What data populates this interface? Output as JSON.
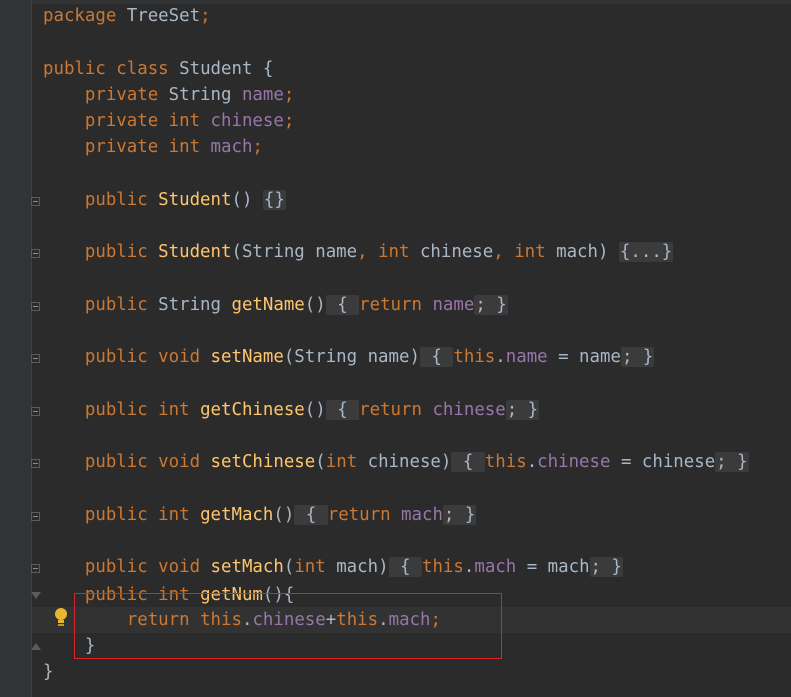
{
  "editor": {
    "lines": [
      {
        "segments": [
          {
            "t": "package ",
            "c": "kw"
          },
          {
            "t": "TreeSet",
            "c": ""
          },
          {
            "t": ";",
            "c": "op"
          }
        ]
      },
      {
        "segments": [
          {
            "t": "public ",
            "c": "kw"
          },
          {
            "t": "class ",
            "c": "kw"
          },
          {
            "t": "Student {",
            "c": ""
          }
        ]
      },
      {
        "segments": [
          {
            "t": "    private ",
            "c": "kw"
          },
          {
            "t": "String ",
            "c": ""
          },
          {
            "t": "name",
            "c": "fld"
          },
          {
            "t": ";",
            "c": "op"
          }
        ]
      },
      {
        "segments": [
          {
            "t": "    private ",
            "c": "kw"
          },
          {
            "t": "int ",
            "c": "kw"
          },
          {
            "t": "chinese",
            "c": "fld"
          },
          {
            "t": ";",
            "c": "op"
          }
        ]
      },
      {
        "segments": [
          {
            "t": "    private ",
            "c": "kw"
          },
          {
            "t": "int ",
            "c": "kw"
          },
          {
            "t": "mach",
            "c": "fld"
          },
          {
            "t": ";",
            "c": "op"
          }
        ]
      },
      {
        "segments": [
          {
            "t": "    public ",
            "c": "kw"
          },
          {
            "t": "Student",
            "c": "fn"
          },
          {
            "t": "() ",
            "c": ""
          },
          {
            "t": "{}",
            "c": "fold"
          }
        ]
      },
      {
        "segments": [
          {
            "t": "    public ",
            "c": "kw"
          },
          {
            "t": "Student",
            "c": "fn"
          },
          {
            "t": "(String name",
            "c": ""
          },
          {
            "t": ", ",
            "c": "op"
          },
          {
            "t": "int ",
            "c": "kw"
          },
          {
            "t": "chinese",
            "c": ""
          },
          {
            "t": ", ",
            "c": "op"
          },
          {
            "t": "int ",
            "c": "kw"
          },
          {
            "t": "mach) ",
            "c": ""
          },
          {
            "t": "{...}",
            "c": "fold"
          }
        ]
      },
      {
        "segments": [
          {
            "t": "    public ",
            "c": "kw"
          },
          {
            "t": "String ",
            "c": ""
          },
          {
            "t": "getName",
            "c": "fn"
          },
          {
            "t": "()",
            "c": ""
          },
          {
            "t": " { ",
            "c": "fold"
          },
          {
            "t": "return ",
            "c": "kw"
          },
          {
            "t": "name",
            "c": "fld"
          },
          {
            "t": "; }",
            "c": "fold"
          }
        ]
      },
      {
        "segments": [
          {
            "t": "    public ",
            "c": "kw"
          },
          {
            "t": "void ",
            "c": "kw"
          },
          {
            "t": "setName",
            "c": "fn"
          },
          {
            "t": "(String name)",
            "c": ""
          },
          {
            "t": " { ",
            "c": "fold"
          },
          {
            "t": "this",
            "c": "kw"
          },
          {
            "t": ".",
            "c": ""
          },
          {
            "t": "name",
            "c": "fld"
          },
          {
            "t": " = name",
            "c": ""
          },
          {
            "t": "; }",
            "c": "fold"
          }
        ]
      },
      {
        "segments": [
          {
            "t": "    public ",
            "c": "kw"
          },
          {
            "t": "int ",
            "c": "kw"
          },
          {
            "t": "getChinese",
            "c": "fn"
          },
          {
            "t": "()",
            "c": ""
          },
          {
            "t": " { ",
            "c": "fold"
          },
          {
            "t": "return ",
            "c": "kw"
          },
          {
            "t": "chinese",
            "c": "fld"
          },
          {
            "t": "; }",
            "c": "fold"
          }
        ]
      },
      {
        "segments": [
          {
            "t": "    public ",
            "c": "kw"
          },
          {
            "t": "void ",
            "c": "kw"
          },
          {
            "t": "setChinese",
            "c": "fn"
          },
          {
            "t": "(",
            "c": ""
          },
          {
            "t": "int ",
            "c": "kw"
          },
          {
            "t": "chinese)",
            "c": ""
          },
          {
            "t": " { ",
            "c": "fold"
          },
          {
            "t": "this",
            "c": "kw"
          },
          {
            "t": ".",
            "c": ""
          },
          {
            "t": "chinese",
            "c": "fld"
          },
          {
            "t": " = chinese",
            "c": ""
          },
          {
            "t": "; }",
            "c": "fold"
          }
        ]
      },
      {
        "segments": [
          {
            "t": "    public ",
            "c": "kw"
          },
          {
            "t": "int ",
            "c": "kw"
          },
          {
            "t": "getMach",
            "c": "fn"
          },
          {
            "t": "()",
            "c": ""
          },
          {
            "t": " { ",
            "c": "fold"
          },
          {
            "t": "return ",
            "c": "kw"
          },
          {
            "t": "mach",
            "c": "fld"
          },
          {
            "t": "; }",
            "c": "fold"
          }
        ]
      },
      {
        "segments": [
          {
            "t": "    public ",
            "c": "kw"
          },
          {
            "t": "void ",
            "c": "kw"
          },
          {
            "t": "setMach",
            "c": "fn"
          },
          {
            "t": "(",
            "c": ""
          },
          {
            "t": "int ",
            "c": "kw"
          },
          {
            "t": "mach)",
            "c": ""
          },
          {
            "t": " { ",
            "c": "fold"
          },
          {
            "t": "this",
            "c": "kw"
          },
          {
            "t": ".",
            "c": ""
          },
          {
            "t": "mach",
            "c": "fld"
          },
          {
            "t": " = mach",
            "c": ""
          },
          {
            "t": "; }",
            "c": "fold"
          }
        ]
      },
      {
        "segments": [
          {
            "t": "    public ",
            "c": "kw"
          },
          {
            "t": "int ",
            "c": "kw"
          },
          {
            "t": "getNum",
            "c": "fn"
          },
          {
            "t": "(){",
            "c": ""
          }
        ]
      },
      {
        "segments": [
          {
            "t": "        return ",
            "c": "kw"
          },
          {
            "t": "this",
            "c": "kw"
          },
          {
            "t": ".",
            "c": ""
          },
          {
            "t": "chinese",
            "c": "fld"
          },
          {
            "t": "+",
            "c": ""
          },
          {
            "t": "this",
            "c": "kw"
          },
          {
            "t": ".",
            "c": ""
          },
          {
            "t": "mach",
            "c": "fld"
          },
          {
            "t": ";",
            "c": "op"
          }
        ]
      },
      {
        "segments": [
          {
            "t": "    }",
            "c": ""
          }
        ]
      },
      {
        "segments": [
          {
            "t": "}",
            "c": ""
          }
        ]
      }
    ]
  },
  "colors": {
    "background": "#2b2b2b",
    "keyword": "#cc7832",
    "field": "#9876aa",
    "method": "#ffc66d",
    "text": "#a9b7c6",
    "highlight_box": "#d92525",
    "intention_bulb": "#e8b630"
  },
  "icons": {
    "fold_marker": "fold-collapse-icon",
    "intention": "lightbulb-icon"
  }
}
